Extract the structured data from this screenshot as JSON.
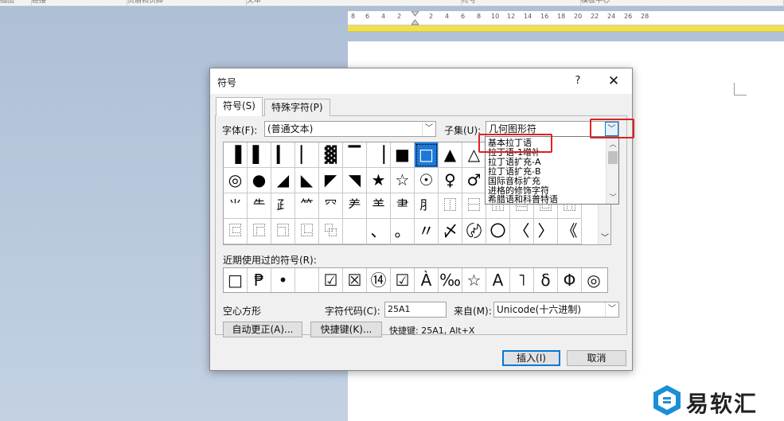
{
  "background": {
    "ribbon_groups": [
      "插图",
      "链接",
      "页眉和页脚",
      "文本",
      "符号",
      "模板中心"
    ],
    "ruler_ticks": [
      "8",
      "6",
      "4",
      "2",
      "2",
      "4",
      "6",
      "8",
      "10",
      "12",
      "14",
      "16",
      "18",
      "20",
      "22",
      "24",
      "26",
      "28"
    ]
  },
  "dialog": {
    "title": "符号",
    "help": "?",
    "close": "✕",
    "tabs": [
      "符号(S)",
      "特殊字符(P)"
    ],
    "font_label": "字体(F):",
    "font_value": "(普通文本)",
    "subset_label": "子集(U):",
    "subset_value": "几何图形符",
    "subset_options": [
      "基本拉丁语",
      "拉丁语-1增补",
      "拉丁语扩充-A",
      "拉丁语扩充-B",
      "国际音标扩充",
      "进格的修饰字符",
      "希腊语和科普特语"
    ],
    "grid": [
      [
        "▐",
        "▌",
        "▎",
        "▏",
        "▓",
        "▔",
        "▕",
        "■",
        "□",
        "▲",
        "△",
        "▶",
        "▷",
        "►",
        "▻",
        "▼"
      ],
      [
        "◎",
        "●",
        "◢",
        "◣",
        "◤",
        "◥",
        "★",
        "☆",
        "☉",
        "♀",
        "♂",
        "☐",
        "☑",
        "☒",
        "♪",
        "♫"
      ],
      [
        "⺌",
        "⺧",
        "⺪",
        "⺮",
        "⺳",
        "⺶",
        "⺷",
        "⺻",
        "⺼",
        "⿰",
        "⿱",
        "⿲",
        "⿳",
        "⿴",
        "⿵",
        "⿶"
      ],
      [
        "⿷",
        "⿸",
        "⿹",
        "⿺",
        "⿻",
        "",
        "、",
        "。",
        "〃",
        "〆",
        "〄",
        "〇",
        "〈",
        "〉",
        "《",
        "》"
      ]
    ],
    "recent_label": "近期使用过的符号(R):",
    "recent": [
      "□",
      "₱",
      "•",
      "",
      "☑",
      "☒",
      "⑭",
      "☑",
      "À",
      "‰",
      "☆",
      "A",
      "˥",
      "δ",
      "Φ",
      "◎"
    ],
    "char_name": "空心方形",
    "char_code_label": "字符代码(C):",
    "char_code_value": "25A1",
    "from_label": "来自(M):",
    "from_value": "Unicode(十六进制)",
    "autocorrect_btn": "自动更正(A)...",
    "shortcut_btn": "快捷键(K)...",
    "shortcut_text": "快捷键: 25A1, Alt+X",
    "insert_btn": "插入(I)",
    "cancel_btn": "取消"
  },
  "logo": {
    "text": "易软汇"
  },
  "colors": {
    "selection": "#1e78d7",
    "highlight_box": "#e02020",
    "margin_band": "#f0e24c"
  }
}
